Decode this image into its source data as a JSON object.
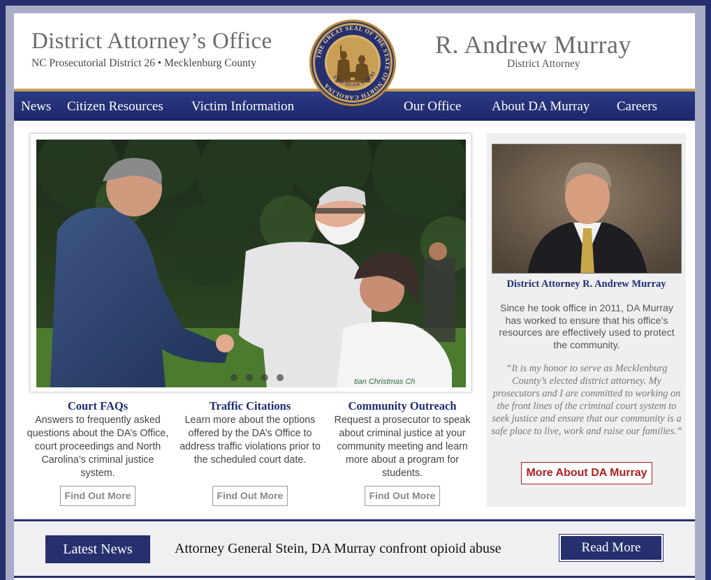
{
  "header": {
    "office_title": "District Attorney’s Office",
    "office_subtitle": "NC Prosecutorial District 26 • Mecklenburg County",
    "da_name": "R. Andrew Murray",
    "da_title": "District Attorney"
  },
  "seal": {
    "ring_text": "THE GREAT SEAL OF THE STATE OF NORTH CAROLINA",
    "motto": "ESSE QUAM VIDERI"
  },
  "nav": {
    "items": [
      {
        "label": "News"
      },
      {
        "label": "Citizen Resources"
      },
      {
        "label": "Victim Information"
      },
      {
        "label": "Our Office"
      },
      {
        "label": "About DA Murray"
      },
      {
        "label": "Careers"
      }
    ]
  },
  "slideshow": {
    "active_index": 3,
    "total": 4,
    "shirt_text": "tian Christmas Ch"
  },
  "features": [
    {
      "title": "Court FAQs",
      "desc": "Answers to frequently asked questions about the DA’s Office, court proceedings and North Carolina’s criminal justice system.",
      "button": "Find Out More"
    },
    {
      "title": "Traffic Citations",
      "desc": "Learn more about the options offered by the DA’s Office to address traffic violations prior to the scheduled court date.",
      "button": "Find Out More"
    },
    {
      "title": "Community Outreach",
      "desc": "Request a prosecutor to speak about criminal justice at your community meeting and learn more about a program for students.",
      "button": "Find Out More"
    }
  ],
  "sidebar": {
    "caption": "District Attorney R. Andrew Murray",
    "bio": "Since he took office in 2011, DA Murray has worked to ensure that his office’s resources are effectively used to protect the community.",
    "quote": "“It is my honor to serve as Mecklenburg County’s elected district attorney. My prosecutors and I are committed to working on the front lines of the criminal court system to seek justice and ensure that our community is a safe place to live, work and raise our families.”",
    "button": "More About DA Murray"
  },
  "news": {
    "label": "Latest News",
    "headline": "Attorney General Stein, DA Murray confront opioid abuse",
    "button": "Read More"
  },
  "colors": {
    "navy": "#26306f",
    "gold": "#c8a355",
    "red": "#b01e1e"
  }
}
